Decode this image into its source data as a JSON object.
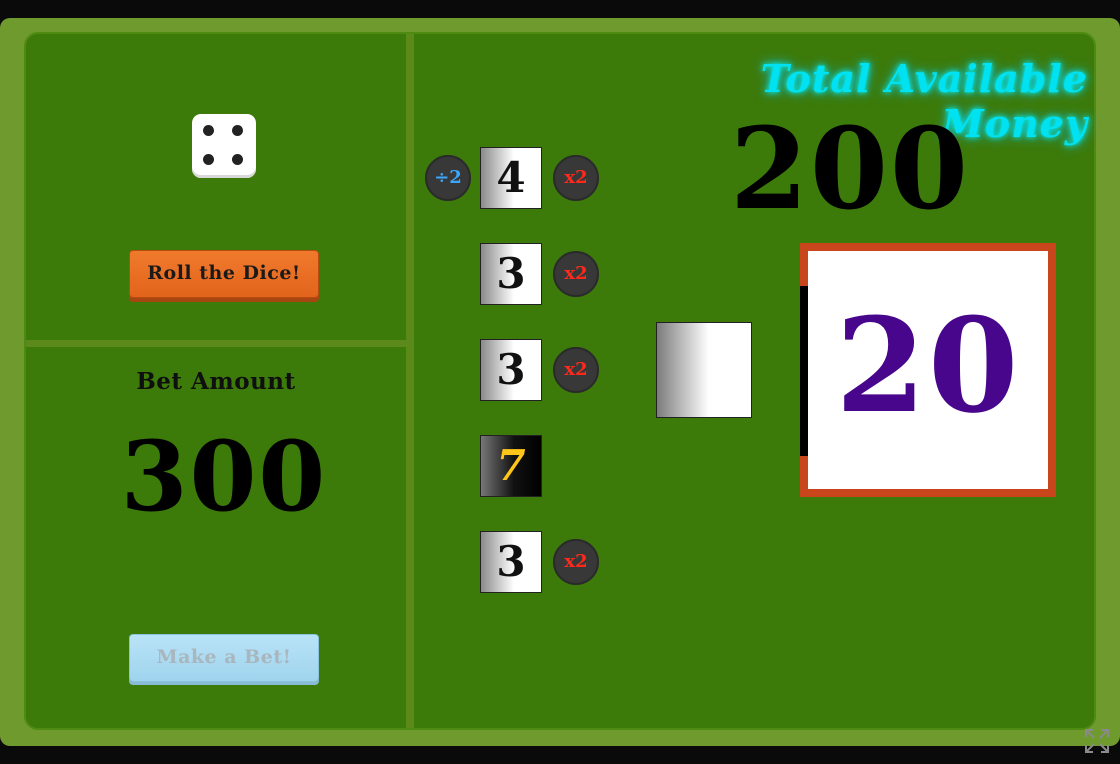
{
  "controls": {
    "roll_label": "Roll the Dice!",
    "bet_label": "Make a Bet!"
  },
  "die": {
    "face": 4
  },
  "bet": {
    "label": "Bet Amount",
    "value": "300"
  },
  "money": {
    "label": "Total Available Money",
    "value": "200"
  },
  "tiles": [
    {
      "value": "4",
      "left_chip": "÷2",
      "right_chip": "x2"
    },
    {
      "value": "3",
      "right_chip": "x2"
    },
    {
      "value": "3",
      "right_chip": "x2"
    },
    {
      "value": "7",
      "highlight": true
    },
    {
      "value": "3",
      "right_chip": "x2"
    }
  ],
  "target": {
    "value": "20"
  },
  "colors": {
    "table": "#3c7a0a",
    "frame": "#6f9a2d",
    "roll_button": "#f07a2c",
    "bet_button": "#b9e3f7",
    "neon": "#00e1f2",
    "target_border": "#c9461c",
    "target_number": "#48068c",
    "seven": "#ffc61a",
    "chip_x2": "#ff2a1a",
    "chip_div2": "#3aa8ff"
  }
}
